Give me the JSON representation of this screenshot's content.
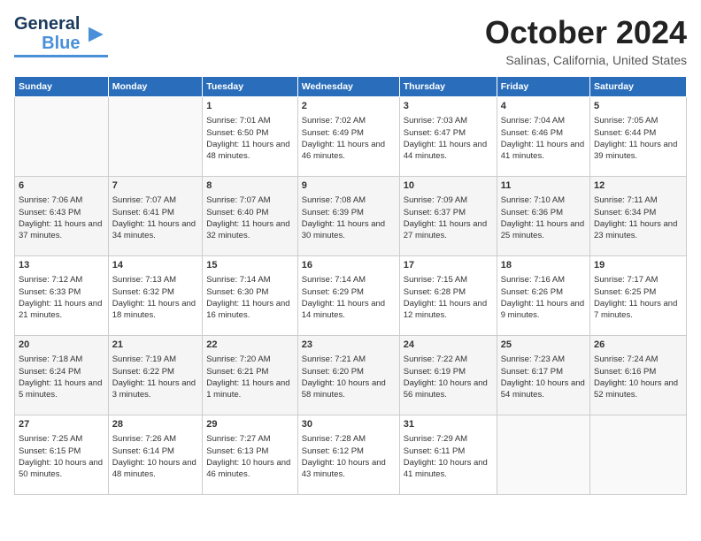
{
  "header": {
    "logo_general": "General",
    "logo_blue": "Blue",
    "month_title": "October 2024",
    "location": "Salinas, California, United States"
  },
  "days_of_week": [
    "Sunday",
    "Monday",
    "Tuesday",
    "Wednesday",
    "Thursday",
    "Friday",
    "Saturday"
  ],
  "weeks": [
    [
      {
        "day": "",
        "info": ""
      },
      {
        "day": "",
        "info": ""
      },
      {
        "day": "1",
        "info": "Sunrise: 7:01 AM\nSunset: 6:50 PM\nDaylight: 11 hours and 48 minutes."
      },
      {
        "day": "2",
        "info": "Sunrise: 7:02 AM\nSunset: 6:49 PM\nDaylight: 11 hours and 46 minutes."
      },
      {
        "day": "3",
        "info": "Sunrise: 7:03 AM\nSunset: 6:47 PM\nDaylight: 11 hours and 44 minutes."
      },
      {
        "day": "4",
        "info": "Sunrise: 7:04 AM\nSunset: 6:46 PM\nDaylight: 11 hours and 41 minutes."
      },
      {
        "day": "5",
        "info": "Sunrise: 7:05 AM\nSunset: 6:44 PM\nDaylight: 11 hours and 39 minutes."
      }
    ],
    [
      {
        "day": "6",
        "info": "Sunrise: 7:06 AM\nSunset: 6:43 PM\nDaylight: 11 hours and 37 minutes."
      },
      {
        "day": "7",
        "info": "Sunrise: 7:07 AM\nSunset: 6:41 PM\nDaylight: 11 hours and 34 minutes."
      },
      {
        "day": "8",
        "info": "Sunrise: 7:07 AM\nSunset: 6:40 PM\nDaylight: 11 hours and 32 minutes."
      },
      {
        "day": "9",
        "info": "Sunrise: 7:08 AM\nSunset: 6:39 PM\nDaylight: 11 hours and 30 minutes."
      },
      {
        "day": "10",
        "info": "Sunrise: 7:09 AM\nSunset: 6:37 PM\nDaylight: 11 hours and 27 minutes."
      },
      {
        "day": "11",
        "info": "Sunrise: 7:10 AM\nSunset: 6:36 PM\nDaylight: 11 hours and 25 minutes."
      },
      {
        "day": "12",
        "info": "Sunrise: 7:11 AM\nSunset: 6:34 PM\nDaylight: 11 hours and 23 minutes."
      }
    ],
    [
      {
        "day": "13",
        "info": "Sunrise: 7:12 AM\nSunset: 6:33 PM\nDaylight: 11 hours and 21 minutes."
      },
      {
        "day": "14",
        "info": "Sunrise: 7:13 AM\nSunset: 6:32 PM\nDaylight: 11 hours and 18 minutes."
      },
      {
        "day": "15",
        "info": "Sunrise: 7:14 AM\nSunset: 6:30 PM\nDaylight: 11 hours and 16 minutes."
      },
      {
        "day": "16",
        "info": "Sunrise: 7:14 AM\nSunset: 6:29 PM\nDaylight: 11 hours and 14 minutes."
      },
      {
        "day": "17",
        "info": "Sunrise: 7:15 AM\nSunset: 6:28 PM\nDaylight: 11 hours and 12 minutes."
      },
      {
        "day": "18",
        "info": "Sunrise: 7:16 AM\nSunset: 6:26 PM\nDaylight: 11 hours and 9 minutes."
      },
      {
        "day": "19",
        "info": "Sunrise: 7:17 AM\nSunset: 6:25 PM\nDaylight: 11 hours and 7 minutes."
      }
    ],
    [
      {
        "day": "20",
        "info": "Sunrise: 7:18 AM\nSunset: 6:24 PM\nDaylight: 11 hours and 5 minutes."
      },
      {
        "day": "21",
        "info": "Sunrise: 7:19 AM\nSunset: 6:22 PM\nDaylight: 11 hours and 3 minutes."
      },
      {
        "day": "22",
        "info": "Sunrise: 7:20 AM\nSunset: 6:21 PM\nDaylight: 11 hours and 1 minute."
      },
      {
        "day": "23",
        "info": "Sunrise: 7:21 AM\nSunset: 6:20 PM\nDaylight: 10 hours and 58 minutes."
      },
      {
        "day": "24",
        "info": "Sunrise: 7:22 AM\nSunset: 6:19 PM\nDaylight: 10 hours and 56 minutes."
      },
      {
        "day": "25",
        "info": "Sunrise: 7:23 AM\nSunset: 6:17 PM\nDaylight: 10 hours and 54 minutes."
      },
      {
        "day": "26",
        "info": "Sunrise: 7:24 AM\nSunset: 6:16 PM\nDaylight: 10 hours and 52 minutes."
      }
    ],
    [
      {
        "day": "27",
        "info": "Sunrise: 7:25 AM\nSunset: 6:15 PM\nDaylight: 10 hours and 50 minutes."
      },
      {
        "day": "28",
        "info": "Sunrise: 7:26 AM\nSunset: 6:14 PM\nDaylight: 10 hours and 48 minutes."
      },
      {
        "day": "29",
        "info": "Sunrise: 7:27 AM\nSunset: 6:13 PM\nDaylight: 10 hours and 46 minutes."
      },
      {
        "day": "30",
        "info": "Sunrise: 7:28 AM\nSunset: 6:12 PM\nDaylight: 10 hours and 43 minutes."
      },
      {
        "day": "31",
        "info": "Sunrise: 7:29 AM\nSunset: 6:11 PM\nDaylight: 10 hours and 41 minutes."
      },
      {
        "day": "",
        "info": ""
      },
      {
        "day": "",
        "info": ""
      }
    ]
  ]
}
